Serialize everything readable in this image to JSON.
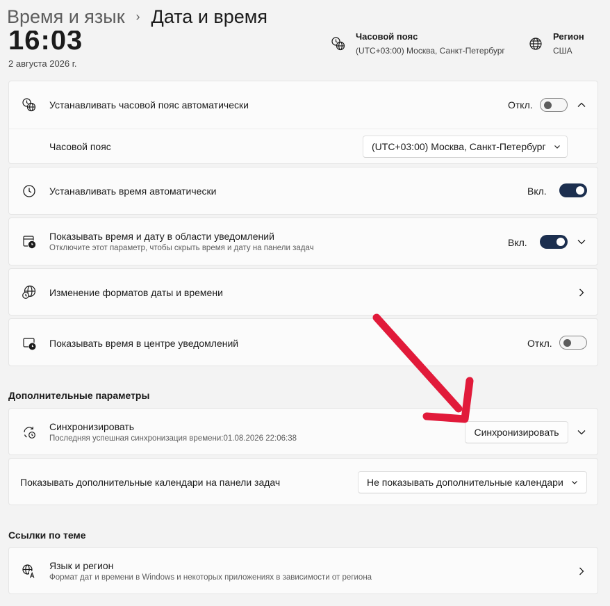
{
  "breadcrumb": {
    "parent": "Время и язык",
    "separator": "›",
    "current": "Дата и время"
  },
  "clock": {
    "time": "16:03",
    "date": "2 августа 2026 г."
  },
  "summary": {
    "timezone": {
      "title": "Часовой пояс",
      "value": "(UTC+03:00) Москва, Санкт-Петербург",
      "icon": "globe-clock-icon"
    },
    "region": {
      "title": "Регион",
      "value": "США",
      "icon": "globe-icon"
    }
  },
  "settings": {
    "auto_timezone": {
      "label": "Устанавливать часовой пояс автоматически",
      "state": "Откл.",
      "on": false
    },
    "timezone_select": {
      "label": "Часовой пояс",
      "value": "(UTC+03:00) Москва, Санкт-Петербург"
    },
    "auto_time": {
      "label": "Устанавливать время автоматически",
      "state": "Вкл.",
      "on": true
    },
    "show_in_tray": {
      "label": "Показывать время и дату в области уведомлений",
      "description": "Отключите этот параметр, чтобы скрыть время и дату на панели задач",
      "state": "Вкл.",
      "on": true
    },
    "change_formats": {
      "label": "Изменение форматов даты и времени"
    },
    "show_in_notification_center": {
      "label": "Показывать время в центре уведомлений",
      "state": "Откл.",
      "on": false
    }
  },
  "additional": {
    "title": "Дополнительные параметры",
    "sync": {
      "label": "Синхронизировать",
      "description": "Последняя успешная синхронизация времени:01.08.2026 22:06:38",
      "button": "Синхронизировать"
    },
    "calendars": {
      "label": "Показывать дополнительные календари на панели задач",
      "value": "Не показывать дополнительные календари"
    }
  },
  "related": {
    "title": "Ссылки по теме",
    "language_region": {
      "label": "Язык и регион",
      "description": "Формат дат и времени в Windows и некоторых приложениях в зависимости от региона"
    }
  },
  "colors": {
    "accent": "#1c2f4f",
    "arrow": "#e11a3a",
    "background": "#f3f3f3",
    "card": "#fbfbfb"
  }
}
